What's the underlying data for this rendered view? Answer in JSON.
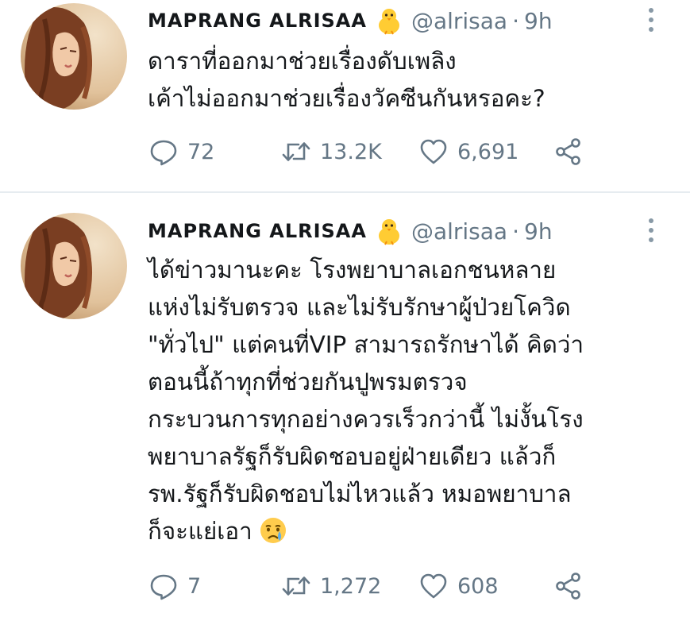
{
  "tweets": [
    {
      "author": {
        "name": "MAPRANG ALRISAA",
        "handle": "@alrisaa",
        "dot": "·",
        "time": "9h"
      },
      "lines": [
        "ดาราที่ออกมาช่วยเรื่องดับเพลิง",
        "เค้าไม่ออกมาช่วยเรื่องวัคซีนกันหรอคะ?"
      ],
      "stats": {
        "replies": "72",
        "retweets": "13.2K",
        "likes": "6,691"
      }
    },
    {
      "author": {
        "name": "MAPRANG ALRISAA",
        "handle": "@alrisaa",
        "dot": "·",
        "time": "9h"
      },
      "lines": [
        "ได้ข่าวมานะคะ โรงพยาบาลเอกชนหลาย",
        "แห่งไม่รับตรวจ และไม่รับรักษาผู้ป่วยโควิด",
        "\"ทั่วไป\" แต่คนที่VIP สามารถรักษาได้ คิดว่า",
        "ตอนนี้ถ้าทุกที่ช่วยกันปูพรมตรวจ",
        "กระบวนการทุกอย่างควรเร็วกว่านี้ ไม่งั้นโรง",
        "พยาบาลรัฐก็รับผิดชอบอยู่ฝ่ายเดียว แล้วก็",
        "รพ.รัฐก็รับผิดชอบไม่ไหวแล้ว หมอพยาบาล",
        "ก็จะแย่เอา"
      ],
      "stats": {
        "replies": "7",
        "retweets": "1,272",
        "likes": "608"
      }
    }
  ],
  "icons": {
    "verified_badge": "chick-emoji",
    "reply": "speech-bubble-icon",
    "retweet": "retweet-icon",
    "like": "heart-icon",
    "share": "share-icon",
    "more": "vertical-dots-icon",
    "end_emoji": "crying-face-emoji"
  },
  "colors": {
    "text": "#14171a",
    "muted": "#657786",
    "divider": "#e6ecf0",
    "chick": "#ffcc33"
  }
}
